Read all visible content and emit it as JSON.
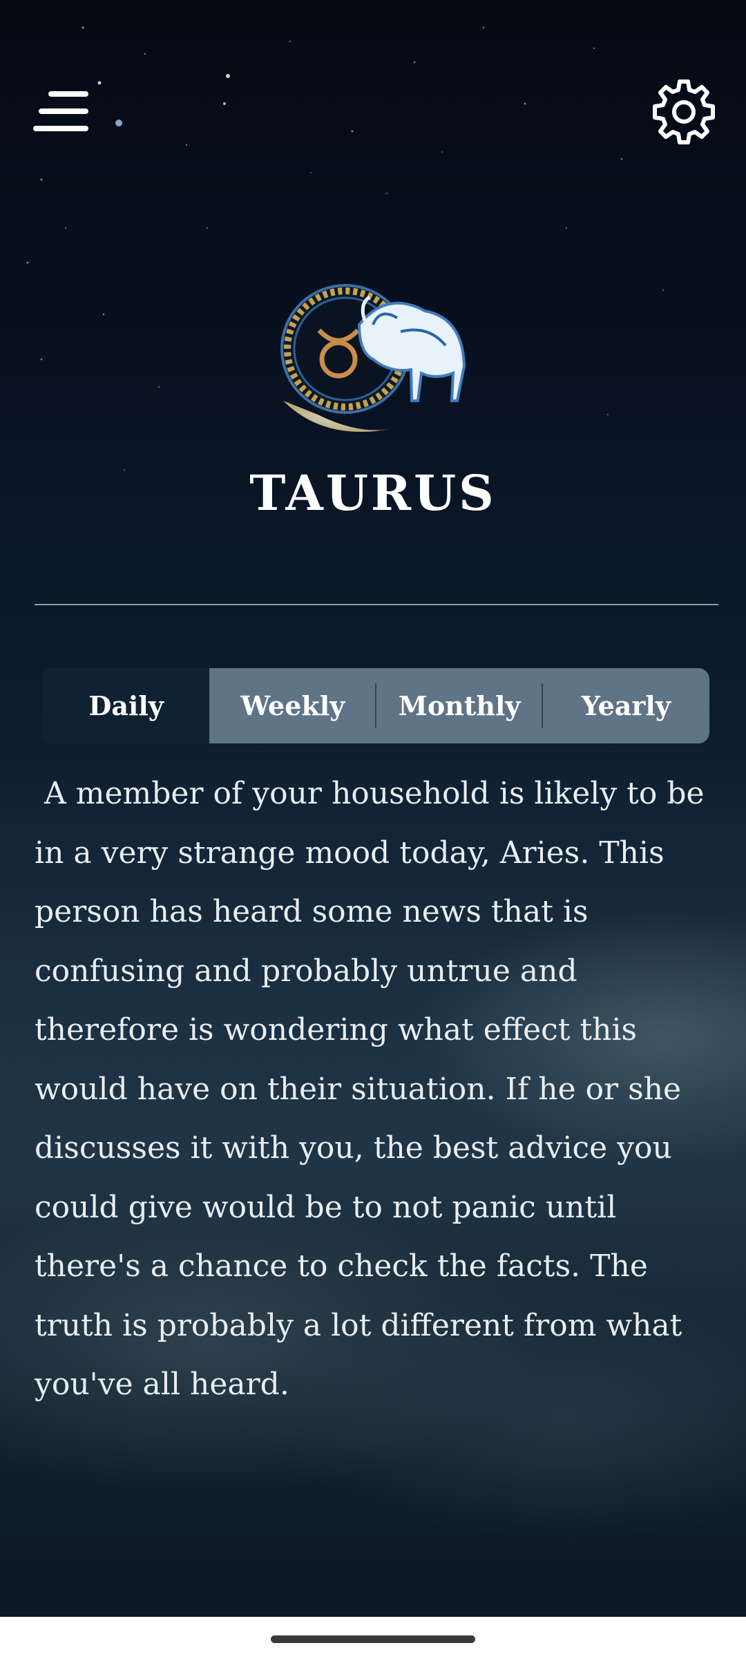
{
  "app": {
    "sign_name": "TAURUS",
    "emblem_icon": "taurus-zodiac-emblem",
    "menu_icon": "hamburger-menu",
    "settings_icon": "gear"
  },
  "tabs": [
    {
      "label": "Daily",
      "active": true
    },
    {
      "label": "Weekly",
      "active": false
    },
    {
      "label": "Monthly",
      "active": false
    },
    {
      "label": "Yearly",
      "active": false
    }
  ],
  "horoscope": {
    "text": " A member of your household is likely to be in a very strange mood today, Aries. This person has heard some news that is confusing and probably untrue and therefore is wondering what effect this would have on their situation. If he or she discusses it with you, the best advice you could give would be to not panic until there's a chance to check the facts. The truth is probably a lot different from what you've all heard."
  },
  "colors": {
    "active_tab": "#0f2234",
    "inactive_tab": "#5f7487",
    "text": "#ffffff"
  }
}
